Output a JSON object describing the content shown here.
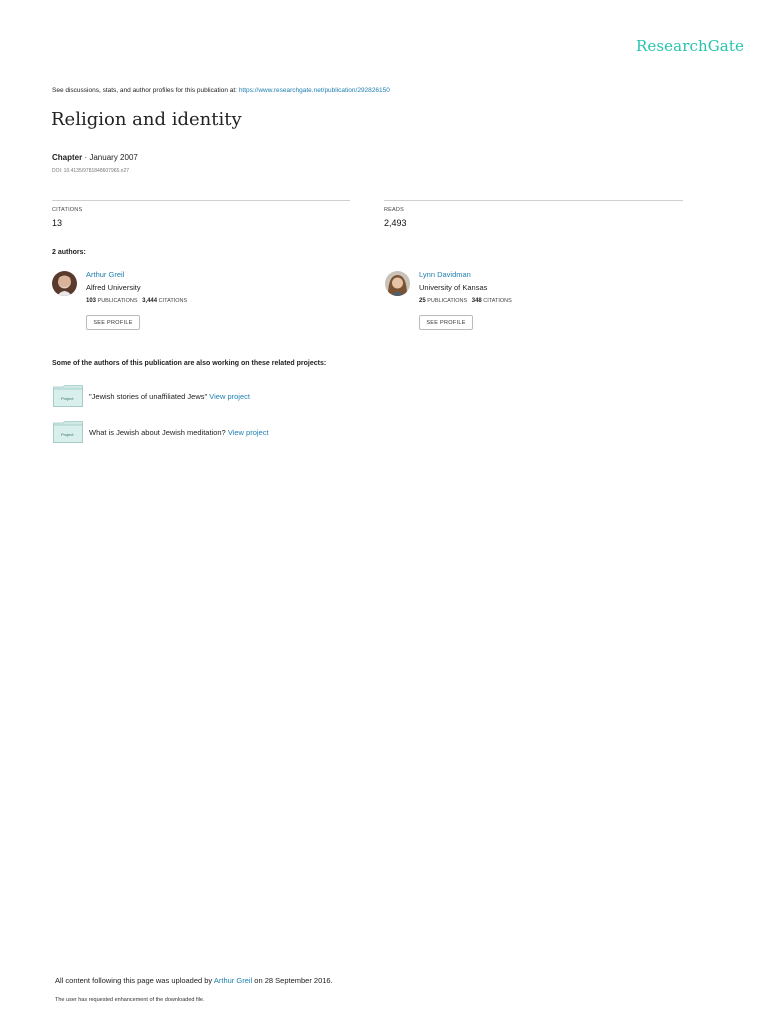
{
  "brand": "ResearchGate",
  "header": {
    "see_discussions": "See discussions, stats, and author profiles for this publication at:",
    "url": "https://www.researchgate.net/publication/292826150"
  },
  "publication": {
    "title": "Religion and identity",
    "type": "Chapter",
    "date": "January 2007",
    "doi": "DOI: 10.4135/9781848607965.n27"
  },
  "stats": {
    "citations_label": "CITATIONS",
    "citations_value": "13",
    "reads_label": "READS",
    "reads_value": "2,493"
  },
  "authors_heading": "2 authors:",
  "authors": [
    {
      "name": "Arthur Greil",
      "institution": "Alfred University",
      "publications": "103",
      "publications_label": "PUBLICATIONS",
      "citations": "3,444",
      "citations_label": "CITATIONS",
      "button": "SEE PROFILE"
    },
    {
      "name": "Lynn Davidman",
      "institution": "University of Kansas",
      "publications": "25",
      "publications_label": "PUBLICATIONS",
      "citations": "348",
      "citations_label": "CITATIONS",
      "button": "SEE PROFILE"
    }
  ],
  "projects_heading": "Some of the authors of this publication are also working on these related projects:",
  "projects": [
    {
      "icon_label": "Project",
      "text": "\"Jewish stories of unaffiliated Jews\"",
      "link": "View project"
    },
    {
      "icon_label": "Project",
      "text": "What is Jewish about Jewish meditation?",
      "link": "View project"
    }
  ],
  "footer": {
    "uploaded_prefix": "All content following this page was uploaded by",
    "uploader": "Arthur Greil",
    "uploaded_suffix": "on 28 September 2016.",
    "enhancement": "The user has requested enhancement of the downloaded file."
  },
  "colors": {
    "brand": "#26c4ae",
    "link": "#1d7fb0",
    "project_icon": "#cfe9e6"
  }
}
